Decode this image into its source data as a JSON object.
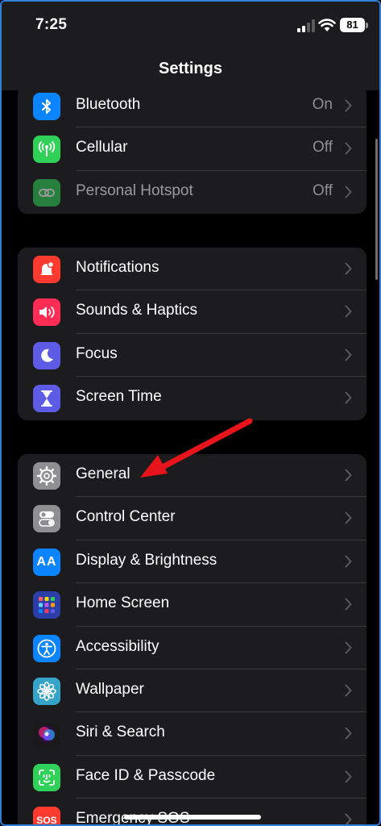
{
  "status_bar": {
    "time": "7:25",
    "battery": "81"
  },
  "nav": {
    "title": "Settings"
  },
  "groups": [
    {
      "items": [
        {
          "label": "Bluetooth",
          "value": "On",
          "icon": "bluetooth-icon",
          "color": "#0a84ff"
        },
        {
          "label": "Cellular",
          "value": "Off",
          "icon": "antenna-icon",
          "color": "#30d158"
        },
        {
          "label": "Personal Hotspot",
          "value": "Off",
          "icon": "chain-link-icon",
          "color": "#30d158"
        }
      ]
    },
    {
      "items": [
        {
          "label": "Notifications",
          "icon": "bell-icon",
          "color": "#ff3b30"
        },
        {
          "label": "Sounds & Haptics",
          "icon": "speaker-icon",
          "color": "#ff2d55"
        },
        {
          "label": "Focus",
          "icon": "moon-icon",
          "color": "#5e5ce6"
        },
        {
          "label": "Screen Time",
          "icon": "hourglass-icon",
          "color": "#5e5ce6"
        }
      ]
    },
    {
      "items": [
        {
          "label": "General",
          "icon": "gear-icon",
          "color": "#8e8e93"
        },
        {
          "label": "Control Center",
          "icon": "toggles-icon",
          "color": "#8e8e93"
        },
        {
          "label": "Display & Brightness",
          "icon": "text-size-icon",
          "color": "#0a84ff"
        },
        {
          "label": "Home Screen",
          "icon": "app-grid-icon",
          "color": "#2c3ea8"
        },
        {
          "label": "Accessibility",
          "icon": "accessibility-icon",
          "color": "#0a84ff"
        },
        {
          "label": "Wallpaper",
          "icon": "flower-icon",
          "color": "#36a3c9"
        },
        {
          "label": "Siri & Search",
          "icon": "siri-icon",
          "color": "#1a1a1a"
        },
        {
          "label": "Face ID & Passcode",
          "icon": "face-id-icon",
          "color": "#30d158"
        },
        {
          "label": "Emergency SOS",
          "icon": "sos-icon",
          "color": "#ff3b30"
        }
      ]
    }
  ],
  "icon_texts": {
    "sos": "SOS",
    "display": "AA"
  }
}
